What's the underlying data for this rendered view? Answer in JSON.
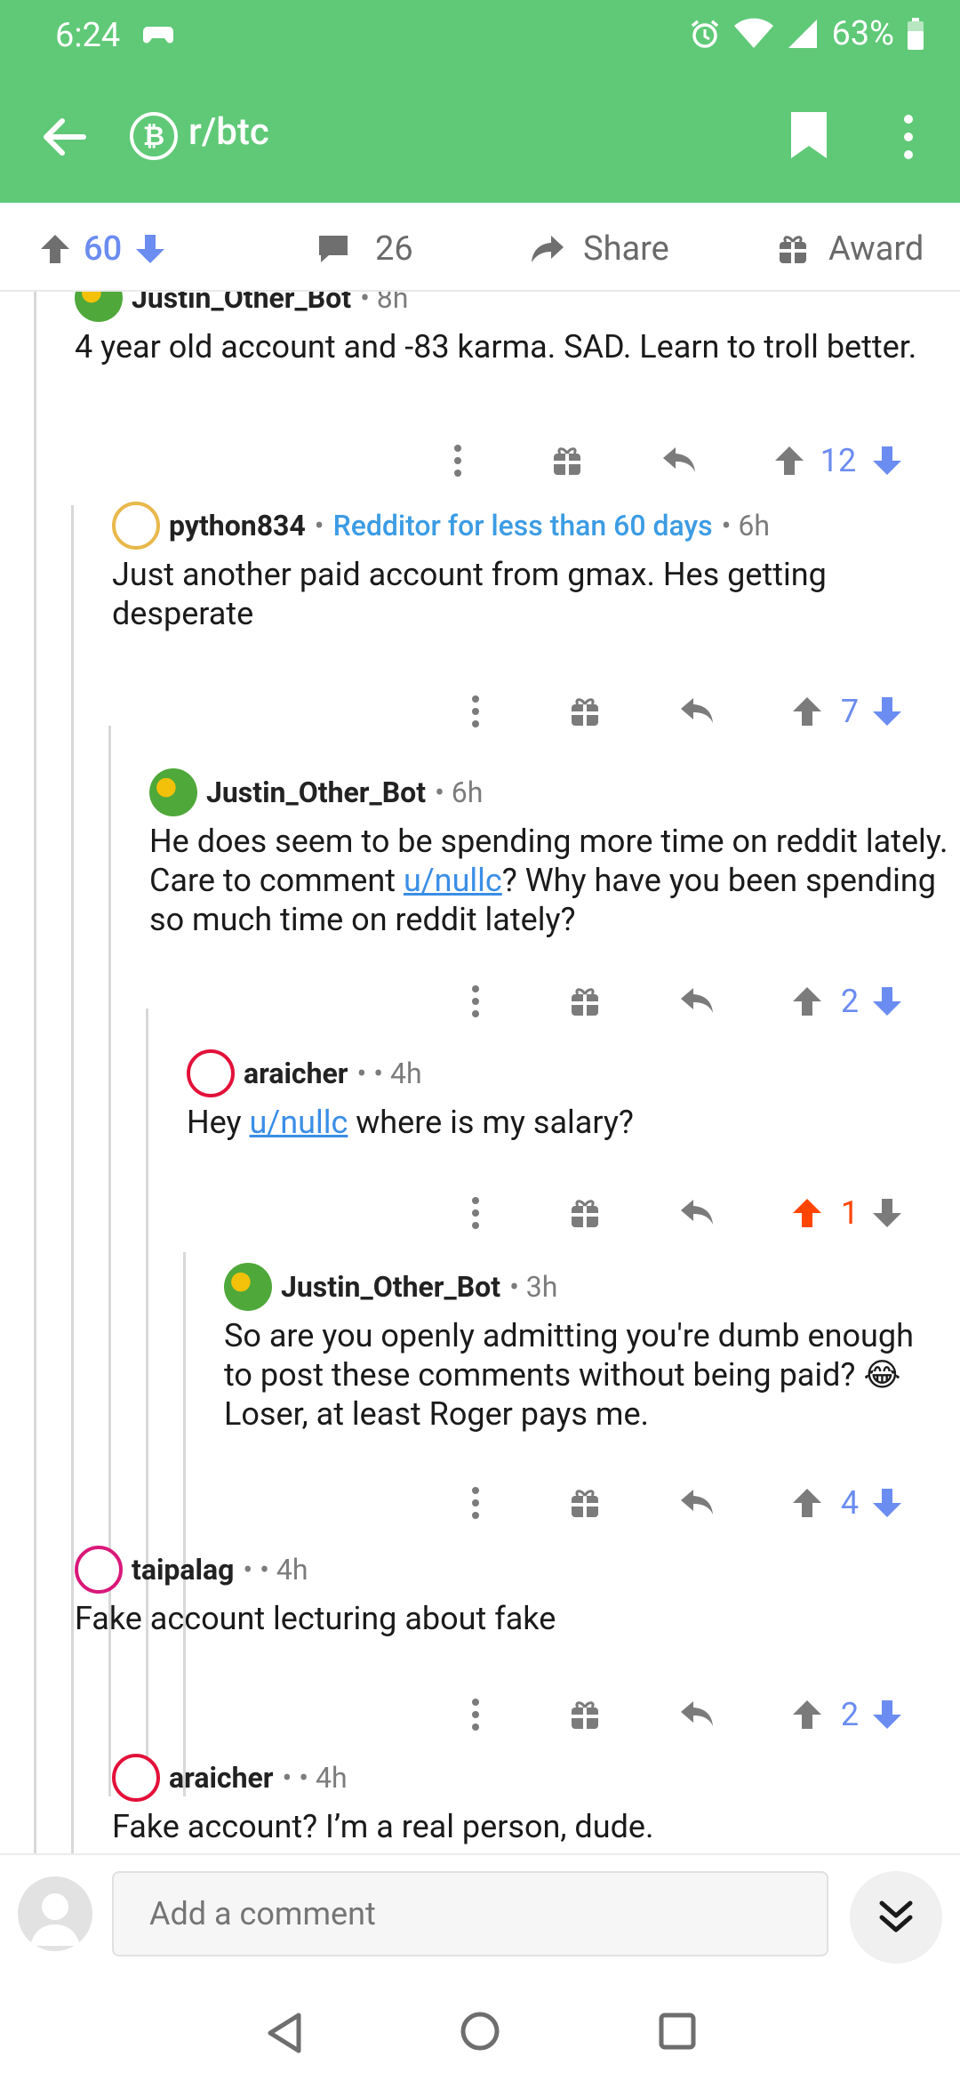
{
  "status": {
    "time": "6:24",
    "battery": "63%"
  },
  "header": {
    "subreddit": "r/btc"
  },
  "post_actions": {
    "score": "60",
    "comments": "26",
    "share": "Share",
    "award": "Award"
  },
  "comments": [
    {
      "user": "Justin_Other_Bot",
      "sep": "•",
      "age": "8h",
      "body": "4 year old account and -83 karma. SAD. Learn to troll better.",
      "score": "12"
    },
    {
      "user": "python834",
      "flair": "Redditor for less than 60 days",
      "age": "6h",
      "body": "Just another paid account from gmax. Hes getting desperate",
      "score": "7"
    },
    {
      "user": "Justin_Other_Bot",
      "age": "6h",
      "body_pre": "He does seem to be spending more time on reddit lately. Care to comment ",
      "mention": "u/nullc",
      "body_post": "? Why have you been spending so much time on reddit lately?",
      "score": "2"
    },
    {
      "user": "araicher",
      "meta": "•  • 4h",
      "body_pre": "Hey ",
      "mention": "u/nullc",
      "body_post": " where is my salary?",
      "score": "1"
    },
    {
      "user": "Justin_Other_Bot",
      "age": "3h",
      "body": "So are you openly admitting you're dumb enough to post these comments without being paid? 😂 Loser, at least Roger pays me.",
      "score": "4"
    },
    {
      "user": "taipalag",
      "meta": "•  • 4h",
      "body": "Fake account lecturing about fake",
      "score": "2"
    },
    {
      "user": "araicher",
      "meta": "•  • 4h",
      "body": "Fake account? I’m a real person, dude."
    }
  ],
  "input": {
    "placeholder": "Add a comment"
  },
  "colors": {
    "header": "#5fc977",
    "upvote": "#6b8cf0",
    "orange": "#ff4500",
    "flair": "#3c9ce4"
  }
}
